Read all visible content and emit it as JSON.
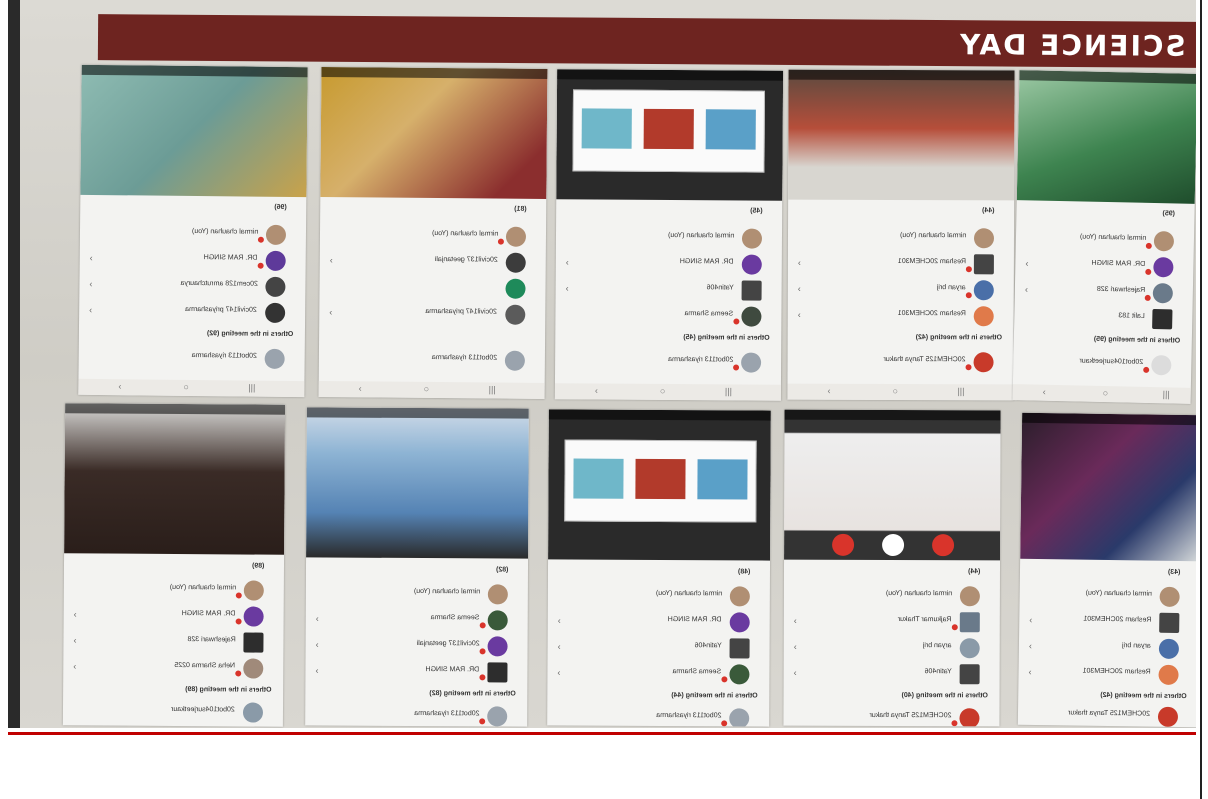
{
  "banner": {
    "title": "SCIENCE DAY"
  },
  "screens": [
    {
      "count": "(96)",
      "section": "Others in the meeting (92)",
      "rows": [
        "nirmal chauhan (You)",
        "DR. RAM SINGH",
        "20cem128 amrutchaurya",
        "20civil147 priyasharma",
        "20bot113 riyasharma"
      ]
    },
    {
      "count": "(81)",
      "section": "",
      "rows": [
        "nirmal chauhan (You)",
        "20civil137 geetanjali",
        "",
        "20civil147 priyasharma",
        "20bot113 riyasharma"
      ]
    },
    {
      "count": "(45)",
      "section": "Others in the meeting (45)",
      "rows": [
        "nirmal chauhan (You)",
        "DR. RAM SINGH",
        "Yatin406",
        "Seema Sharma",
        "20bot113 riyasharma"
      ]
    },
    {
      "count": "(44)",
      "section": "Others in the meeting (42)",
      "rows": [
        "nirmal chauhan (You)",
        "Resham 20CHEM301",
        "aryan brij",
        "Resham 20CHEM301",
        "20CHEM125 Tanya thakur"
      ]
    },
    {
      "count": "(95)",
      "section": "Others in the meeting (95)",
      "rows": [
        "nirmal chauhan (You)",
        "DR. RAM SINGH",
        "Rajeshwari 328",
        "Lalit 183",
        "20bot104surjeetkaur"
      ]
    },
    {
      "count": "(89)",
      "section": "Others in the meeting (89)",
      "rows": [
        "nirmal chauhan (You)",
        "DR. RAM SINGH",
        "Rajeshwari 328",
        "Neha Sharma 0225",
        "20bot104surjeetkaur"
      ]
    },
    {
      "count": "(82)",
      "section": "Others in the meeting (82)",
      "rows": [
        "nirmal chauhan (You)",
        "Seema Sharma",
        "20civil137 geetanjali",
        "DR. RAM SINGH",
        "20bot113 riyasharma"
      ]
    },
    {
      "count": "(48)",
      "section": "Others in the meeting (44)",
      "rows": [
        "nirmal chauhan (You)",
        "DR. RAM SINGH",
        "Yatin406",
        "Seema Sharma",
        "20bot113 riyasharma"
      ]
    },
    {
      "count": "(44)",
      "section": "Others in the meeting (40)",
      "rows": [
        "nirmal chauhan (You)",
        "Rajkumar Thakur",
        "aryan brij",
        "Yatin406",
        "20CHEM125 Tanya thakur"
      ]
    },
    {
      "count": "(43)",
      "section": "Others in the meeting (42)",
      "rows": [
        "nirmal chauhan (You)",
        "Resham 20CHEM301",
        "aryan brij",
        "Resham 20CHEM301",
        "20CHEM125 Tanya thakur"
      ]
    }
  ],
  "colors": {
    "banner": "#6e2420",
    "footer_line": "#c00000"
  }
}
